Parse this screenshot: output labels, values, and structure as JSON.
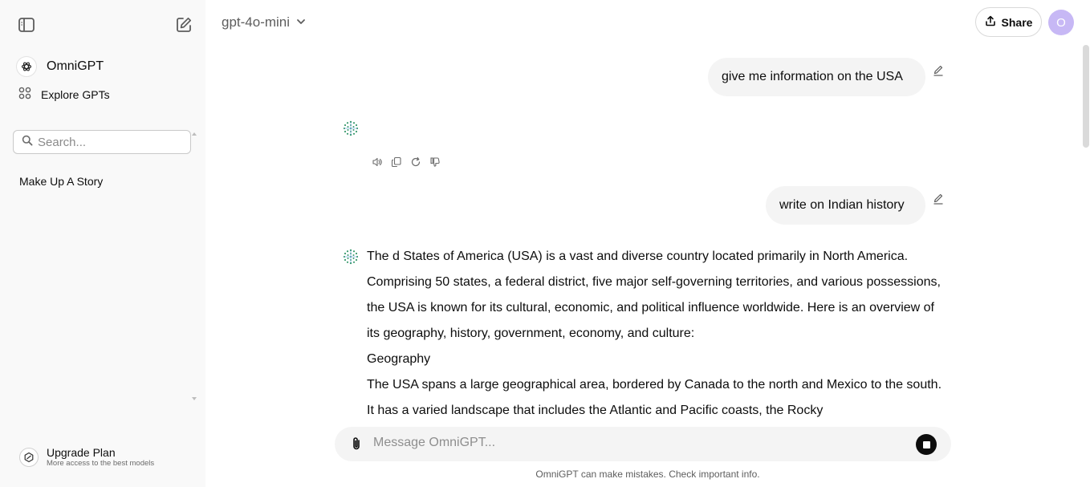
{
  "sidebar": {
    "brand_label": "OmniGPT",
    "explore_label": "Explore GPTs",
    "search_placeholder": "Search...",
    "history": [
      {
        "label": "Make Up A Story"
      }
    ],
    "upgrade": {
      "title": "Upgrade Plan",
      "subtitle": "More access to the best models"
    }
  },
  "header": {
    "model": "gpt-4o-mini",
    "share_label": "Share",
    "avatar_initial": "O"
  },
  "chat": {
    "messages": [
      {
        "role": "user",
        "text": "give me information on the USA"
      },
      {
        "role": "assistant",
        "text": ""
      },
      {
        "role": "user",
        "text": "write on Indian history"
      },
      {
        "role": "assistant",
        "paragraphs": [
          "The d States of America (USA) is a vast and diverse country located primarily in North America. Comprising 50 states, a federal district, five major self-governing territories, and various possessions, the USA is known for its cultural, economic, and political influence worldwide. Here is an overview of its geography, history, government, economy, and culture:",
          "Geography",
          "The USA spans a large geographical area, bordered by Canada to the north and Mexico to the south. It has a varied landscape that includes the Atlantic and Pacific coasts, the Rocky"
        ]
      }
    ]
  },
  "composer": {
    "placeholder": "Message OmniGPT...",
    "disclaimer": "OmniGPT can make mistakes. Check important info."
  },
  "colors": {
    "sidebar_bg": "#f9f9f9",
    "bubble_bg": "#f4f4f4",
    "avatar_bg": "#c7b8f5",
    "bot_icon": "#3a9a6e"
  }
}
